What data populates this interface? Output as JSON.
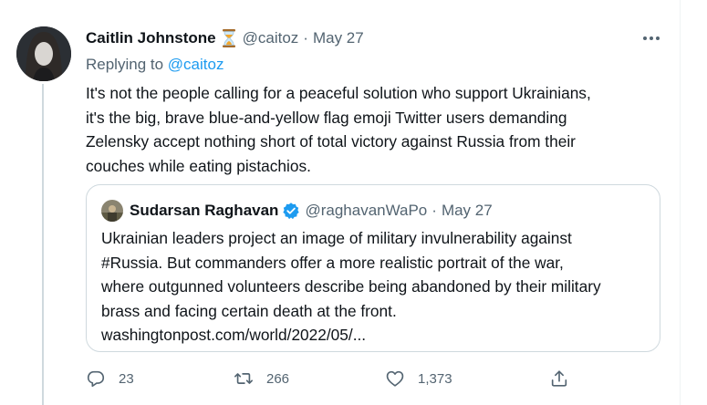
{
  "tweet": {
    "author_name": "Caitlin Johnstone",
    "author_emoji_icon": "hourglass-icon",
    "author_handle": "@caitoz",
    "separator": "·",
    "date": "May 27",
    "replying_prefix": "Replying to",
    "replying_to": "@caitoz",
    "text_lines": [
      "It's not the people calling for a peaceful solution who support Ukrainians,",
      "it's the big, brave blue-and-yellow flag emoji Twitter users demanding",
      "Zelensky accept nothing short of total victory against Russia from their",
      "couches while eating pistachios."
    ]
  },
  "quote": {
    "author_name": "Sudarsan Raghavan",
    "verified_icon": "verified-badge-icon",
    "author_handle": "@raghavanWaPo",
    "separator": "·",
    "date": "May 27",
    "text_lines": [
      "Ukrainian leaders project an image of military invulnerability against",
      "#Russia. But commanders offer a more realistic portrait of the war,",
      "where outgunned volunteers describe being abandoned by their military",
      "brass and facing certain death at the front.",
      "washingtonpost.com/world/2022/05/..."
    ]
  },
  "actions": {
    "reply": {
      "icon": "reply-icon",
      "count": "23"
    },
    "retweet": {
      "icon": "retweet-icon",
      "count": "266"
    },
    "like": {
      "icon": "heart-icon",
      "count": "1,373"
    },
    "share": {
      "icon": "share-icon"
    }
  },
  "colors": {
    "accent": "#1d9bf0",
    "secondary_text": "#536471",
    "primary_text": "#0f1419",
    "border": "#cfd9de"
  }
}
